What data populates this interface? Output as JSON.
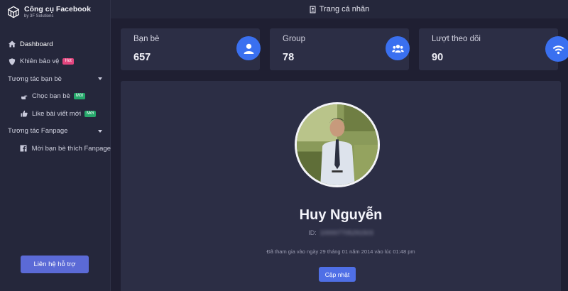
{
  "brand": {
    "title": "Công cụ Facebook",
    "subtitle": "by 3F Solutions",
    "logo_icon": "cube-logo-icon"
  },
  "topbar": {
    "title": "Trang cá nhân",
    "icon": "id-badge-icon"
  },
  "sidebar": {
    "items": [
      {
        "label": "Dashboard",
        "icon": "home-icon"
      },
      {
        "label": "Khiên bảo vệ",
        "icon": "shield-icon",
        "badge": "Hot"
      },
      {
        "label": "Tương tác bạn bè"
      },
      {
        "label": "Chọc bạn bè",
        "icon": "poke-icon",
        "badge": "Mới"
      },
      {
        "label": "Like bài viết mới",
        "icon": "thumbs-up-icon",
        "badge": "Mới"
      },
      {
        "label": "Tương tác Fanpage"
      },
      {
        "label": "Mời bạn bè thích Fanpage",
        "icon": "facebook-icon"
      }
    ],
    "support_label": "Liên hệ hỗ trợ"
  },
  "stats": [
    {
      "label": "Bạn bè",
      "value": "657",
      "icon": "user-icon"
    },
    {
      "label": "Group",
      "value": "78",
      "icon": "users-icon"
    },
    {
      "label": "Lượt theo dõi",
      "value": "90",
      "icon": "wifi-icon"
    }
  ],
  "profile": {
    "name": "Huy Nguyễn",
    "id_label": "ID:",
    "id_value": "100007705291503",
    "joined": "Đã tham gia vào ngày 29 tháng 01 năm 2014 vào lúc 01:48 pm",
    "update_label": "Cập nhật"
  },
  "colors": {
    "background": "#1f1f32",
    "sidebar": "#25273b",
    "card": "#2c2e45",
    "accent": "#3a70f0",
    "hot_badge": "#e2457e",
    "new_badge": "#26a86b"
  }
}
